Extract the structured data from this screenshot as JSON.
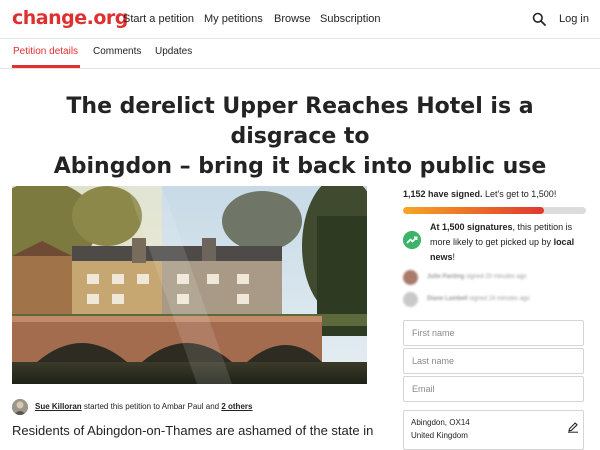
{
  "brand": {
    "logo_text": "change.org",
    "accent": "#e02f2f"
  },
  "nav": {
    "links": [
      "Start a petition",
      "My petitions",
      "Browse",
      "Subscription"
    ],
    "login": "Log in",
    "search_icon": "search-icon"
  },
  "tabs": [
    "Petition details",
    "Comments",
    "Updates"
  ],
  "petition": {
    "title_line1": "The derelict Upper Reaches Hotel is a disgrace to",
    "title_line2": "Abingdon – bring it back into public use",
    "starter_name": "Sue Killoran",
    "starter_action": " started this petition to ",
    "recipient": "Ambar Paul",
    "and_text": " and ",
    "others": "2 others",
    "description_start": "Residents of Abingdon-on-Thames are ashamed of the state in"
  },
  "signatures": {
    "signed_text": "1,152 have signed.",
    "goal_text": " Let's get to 1,500!",
    "signed": 1152,
    "goal": 1500,
    "milestone_bold": "At 1,500 signatures",
    "milestone_rest": ", this petition is more likely to get picked up by ",
    "milestone_news": "local news",
    "milestone_end": "!",
    "bar_start_color": "#f5a623",
    "bar_end_color": "#e0382f",
    "trend_icon": "trending-up-icon"
  },
  "recent_signers": [
    {
      "name": "Julie Panting",
      "when": " signed 20 minutes ago"
    },
    {
      "name": "Diane Lambell",
      "when": " signed 24 minutes ago"
    }
  ],
  "form": {
    "first_name_placeholder": "First name",
    "last_name_placeholder": "Last name",
    "email_placeholder": "Email",
    "location_line1": "Abingdon, OX14",
    "location_line2": "United Kingdom",
    "edit_icon": "edit-icon"
  }
}
